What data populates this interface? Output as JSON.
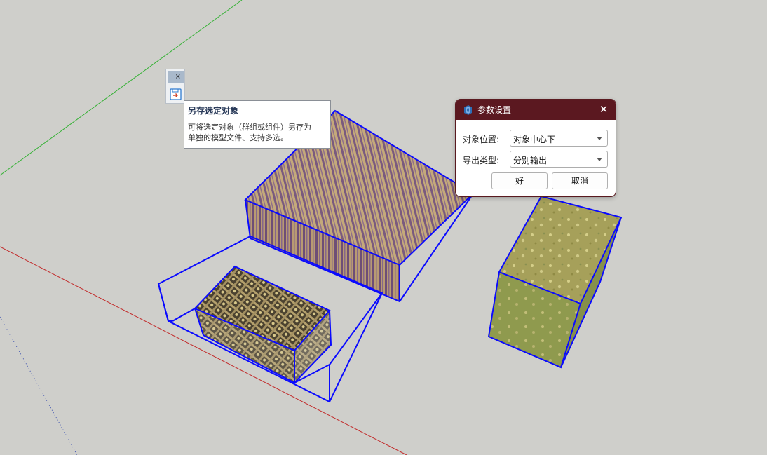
{
  "toolbar": {
    "close_glyph": "×",
    "save_icon": "save-as-icon"
  },
  "tooltip": {
    "title": "另存选定对象",
    "line1": "可将选定对象（群组或组件）另存为",
    "line2": "单独的模型文件、支持多选。"
  },
  "dialog": {
    "title": "参数设置",
    "close_glyph": "✕",
    "fields": [
      {
        "label": "对象位置:",
        "value": "对象中心下"
      },
      {
        "label": "导出类型:",
        "value": "分别输出"
      }
    ],
    "ok_label": "好",
    "cancel_label": "取消"
  },
  "colors": {
    "background": "#cfcfcb",
    "selection": "#0a0aff",
    "axis_green": "#35b135",
    "axis_red": "#c22a2a",
    "axis_blue_dotted": "#3a4fb0",
    "dialog_titlebar": "#5b1820"
  }
}
